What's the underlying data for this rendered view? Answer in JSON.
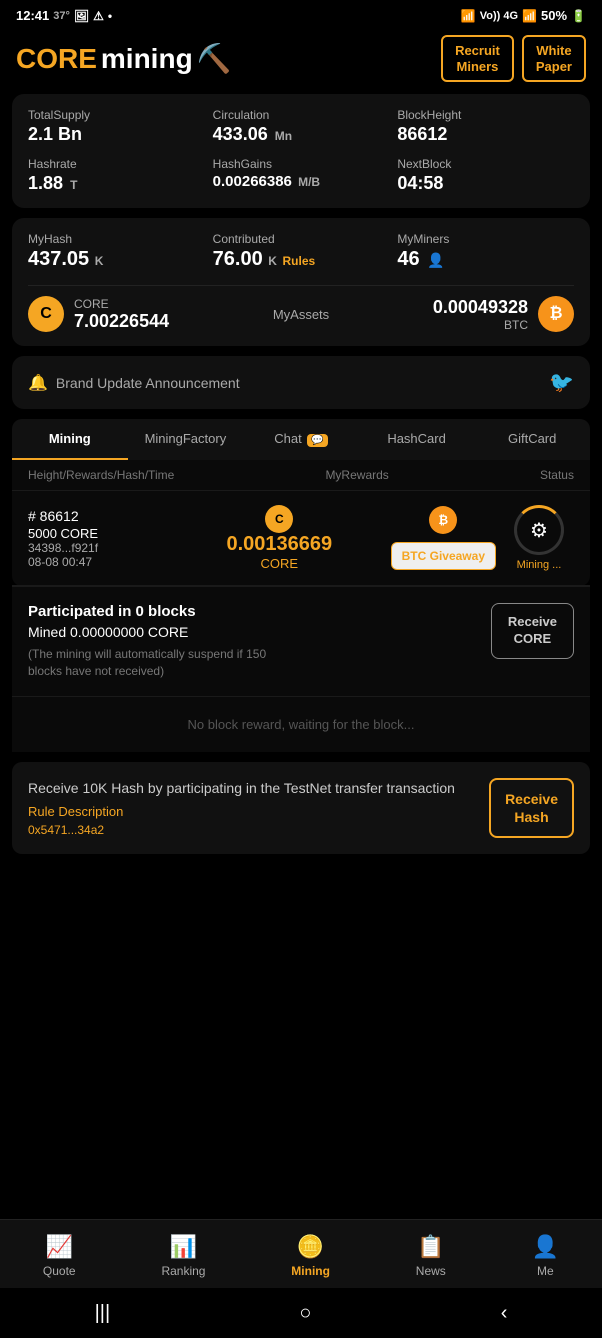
{
  "statusBar": {
    "time": "12:41",
    "degree": "37°",
    "battery": "50%"
  },
  "header": {
    "logo": "CORE",
    "logo2": "mining",
    "btn1": "Recruit\nMiners",
    "btn2": "White\nPaper"
  },
  "stats": {
    "totalSupplyLabel": "TotalSupply",
    "totalSupplyValue": "2.1 Bn",
    "circulationLabel": "Circulation",
    "circulationValue": "433.06",
    "circulationUnit": "Mn",
    "blockHeightLabel": "BlockHeight",
    "blockHeightValue": "86612",
    "hashrateLabel": "Hashrate",
    "hashrateValue": "1.88",
    "hashrateUnit": "T",
    "hashGainsLabel": "HashGains",
    "hashGainsValue": "0.00266386",
    "hashGainsUnit": "M/B",
    "nextBlockLabel": "NextBlock",
    "nextBlockValue": "04:58"
  },
  "mining": {
    "myHashLabel": "MyHash",
    "myHashValue": "437.05",
    "myHashUnit": "K",
    "contributedLabel": "Contributed",
    "contributedValue": "76.00",
    "contributedUnit": "K",
    "rulesLink": "Rules",
    "myMinersLabel": "MyMiners",
    "myMinersValue": "46"
  },
  "assets": {
    "coreLabel": "CORE",
    "coreValue": "7.00226544",
    "myAssetsLabel": "MyAssets",
    "btcValue": "0.00049328",
    "btcLabel": "BTC"
  },
  "announcement": {
    "text": "Brand Update Announcement"
  },
  "tabs": [
    {
      "id": "mining",
      "label": "Mining",
      "active": true
    },
    {
      "id": "miningfactory",
      "label": "MiningFactory",
      "active": false
    },
    {
      "id": "chat",
      "label": "Chat",
      "active": false,
      "badge": "💬"
    },
    {
      "id": "hashcard",
      "label": "HashCard",
      "active": false
    },
    {
      "id": "giftcard",
      "label": "GiftCard",
      "active": false
    }
  ],
  "miningContent": {
    "col1": "Height/Rewards/Hash/Time",
    "col2": "MyRewards",
    "col3": "Status",
    "blockNum": "# 86612",
    "blockReward": "5000 CORE",
    "hashId": "34398...f921f",
    "time": "08-08 00:47",
    "coreAmount": "0.00136669",
    "coreLabel": "CORE",
    "btcGiveaway": "BTC Giveaway",
    "miningStatus": "Mining ..."
  },
  "participated": {
    "title": "Participated in 0 blocks",
    "mined": "Mined 0.00000000 CORE",
    "note": "(The mining will automatically suspend if 150 blocks have not received)",
    "btnLine1": "Receive",
    "btnLine2": "CORE"
  },
  "noReward": {
    "text": "No block reward, waiting for the block..."
  },
  "receiveHash": {
    "title": "Receive 10K Hash by participating in the TestNet transfer transaction",
    "ruleLabel": "Rule Description",
    "address": "0x5471...34a2",
    "btnLine1": "Receive",
    "btnLine2": "Hash"
  },
  "bottomNav": [
    {
      "id": "quote",
      "label": "Quote",
      "icon": "📈",
      "active": false
    },
    {
      "id": "ranking",
      "label": "Ranking",
      "icon": "📊",
      "active": false
    },
    {
      "id": "mining-center",
      "label": "Mining",
      "icon": "🪙",
      "active": true,
      "isMining": true
    },
    {
      "id": "news",
      "label": "News",
      "icon": "📋",
      "active": false
    },
    {
      "id": "me",
      "label": "Me",
      "icon": "👤",
      "active": false
    }
  ],
  "sysNav": {
    "back": "|||",
    "home": "○",
    "recent": "<"
  }
}
